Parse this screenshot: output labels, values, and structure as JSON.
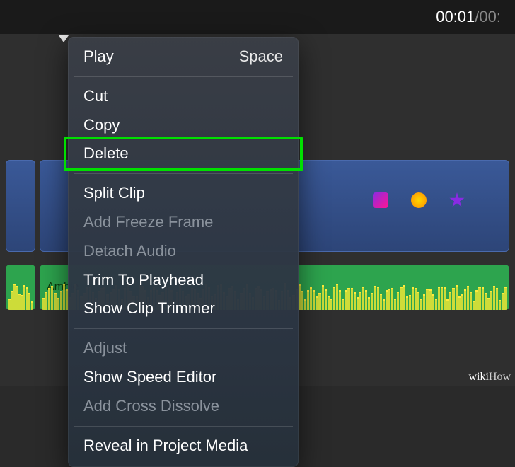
{
  "topbar": {
    "current_time": "00:01",
    "separator": " / ",
    "total_time": "00:"
  },
  "timeline": {
    "audio_clip_label": "Ambie"
  },
  "context_menu": {
    "items": [
      {
        "label": "Play",
        "shortcut": "Space",
        "enabled": true
      },
      {
        "separator": true
      },
      {
        "label": "Cut",
        "enabled": true
      },
      {
        "label": "Copy",
        "enabled": true
      },
      {
        "label": "Delete",
        "enabled": true,
        "highlighted": true
      },
      {
        "separator": true
      },
      {
        "label": "Split Clip",
        "enabled": true
      },
      {
        "label": "Add Freeze Frame",
        "enabled": false
      },
      {
        "label": "Detach Audio",
        "enabled": false
      },
      {
        "label": "Trim To Playhead",
        "enabled": true
      },
      {
        "label": "Show Clip Trimmer",
        "enabled": true
      },
      {
        "separator": true
      },
      {
        "label": "Adjust",
        "enabled": false
      },
      {
        "label": "Show Speed Editor",
        "enabled": true
      },
      {
        "label": "Add Cross Dissolve",
        "enabled": false
      },
      {
        "separator": true
      },
      {
        "label": "Reveal in Project Media",
        "enabled": true
      }
    ]
  },
  "watermark": {
    "brand1": "wiki",
    "brand2": "How"
  }
}
